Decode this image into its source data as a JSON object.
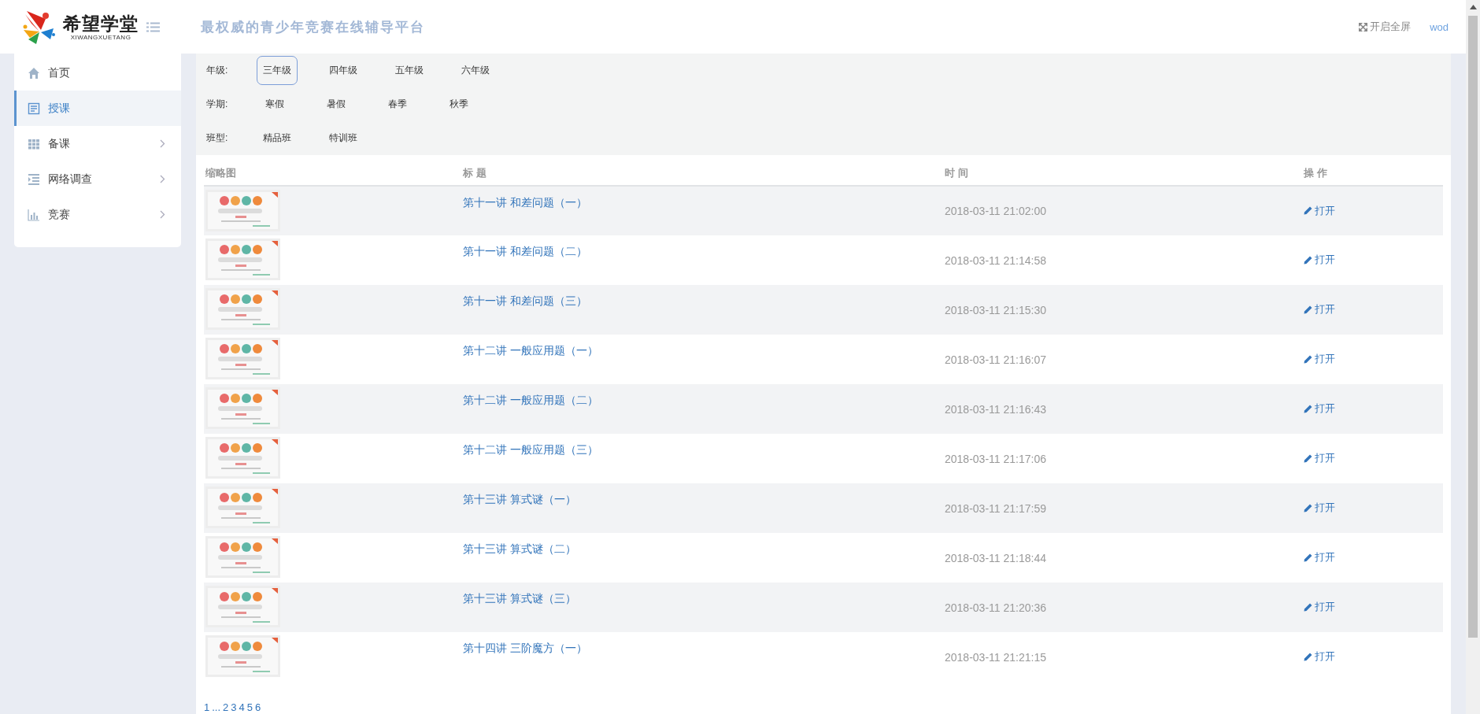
{
  "header": {
    "brand": "希望学堂",
    "brand_sub": "XIWANGXUETANG",
    "slogan": "最权威的青少年竞赛在线辅导平台",
    "fullscreen": "开启全屏",
    "user": "wod"
  },
  "sidebar": {
    "items": [
      {
        "label": "首页",
        "selected": false,
        "has_submenu": false
      },
      {
        "label": "授课",
        "selected": true,
        "has_submenu": false
      },
      {
        "label": "备课",
        "selected": false,
        "has_submenu": true
      },
      {
        "label": "网络调查",
        "selected": false,
        "has_submenu": true
      },
      {
        "label": "竞赛",
        "selected": false,
        "has_submenu": true
      }
    ]
  },
  "filters": [
    {
      "label": "年级:",
      "options": [
        {
          "label": "三年级",
          "selected": true
        },
        {
          "label": "四年级",
          "selected": false
        },
        {
          "label": "五年级",
          "selected": false
        },
        {
          "label": "六年级",
          "selected": false
        }
      ]
    },
    {
      "label": "学期:",
      "options": [
        {
          "label": "寒假",
          "selected": false
        },
        {
          "label": "暑假",
          "selected": false
        },
        {
          "label": "春季",
          "selected": false
        },
        {
          "label": "秋季",
          "selected": false
        }
      ]
    },
    {
      "label": "班型:",
      "options": [
        {
          "label": "精品班",
          "selected": false
        },
        {
          "label": "特训班",
          "selected": false
        }
      ]
    }
  ],
  "table": {
    "columns": [
      "缩略图",
      "标 题",
      "时 间",
      "操 作"
    ],
    "rows": [
      {
        "title": "第十一讲 和差问题（一）",
        "time": "2018-03-11 21:02:00",
        "action": "打开"
      },
      {
        "title": "第十一讲 和差问题（二）",
        "time": "2018-03-11 21:14:58",
        "action": "打开"
      },
      {
        "title": "第十一讲 和差问题（三）",
        "time": "2018-03-11 21:15:30",
        "action": "打开"
      },
      {
        "title": "第十二讲 一般应用题（一）",
        "time": "2018-03-11 21:16:07",
        "action": "打开"
      },
      {
        "title": "第十二讲 一般应用题（二）",
        "time": "2018-03-11 21:16:43",
        "action": "打开"
      },
      {
        "title": "第十二讲 一般应用题（三）",
        "time": "2018-03-11 21:17:06",
        "action": "打开"
      },
      {
        "title": "第十三讲 算式谜（一）",
        "time": "2018-03-11 21:17:59",
        "action": "打开"
      },
      {
        "title": "第十三讲 算式谜（二）",
        "time": "2018-03-11 21:18:44",
        "action": "打开"
      },
      {
        "title": "第十三讲 算式谜（三）",
        "time": "2018-03-11 21:20:36",
        "action": "打开"
      },
      {
        "title": "第十四讲 三阶魔方（一）",
        "time": "2018-03-11 21:21:15",
        "action": "打开"
      }
    ]
  },
  "pagination": [
    "1",
    "...",
    "2",
    "3",
    "4",
    "5",
    "6"
  ]
}
